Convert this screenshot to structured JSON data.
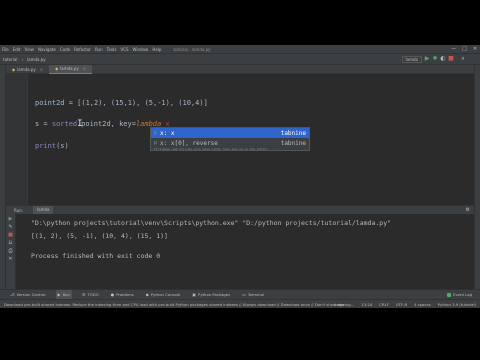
{
  "window": {
    "menu": [
      "File",
      "Edit",
      "View",
      "Navigate",
      "Code",
      "Refactor",
      "Run",
      "Tools",
      "VCS",
      "Window",
      "Help"
    ],
    "title": "tutorial - lamda.py",
    "controls": [
      "—",
      "□",
      "✕"
    ]
  },
  "navbar": {
    "breadcrumbs": [
      "tutorial",
      "lamda.py"
    ],
    "run_config": "lamda"
  },
  "tabs": [
    {
      "label": "lamda.py",
      "icon": "python-file-icon",
      "active": false
    },
    {
      "label": "lamda.py",
      "icon": "python-file-icon",
      "active": true
    }
  ],
  "editor": {
    "line1": "point2d = [(1,2), (15,1), (5,-1), (10,4)]",
    "line2_a": "s = ",
    "line2_fn": "sorted",
    "line2_b": "point2d, key=",
    "line2_lam": "lambda",
    "line2_c": " x",
    "line3_fn": "print",
    "line3_rest": "(s)",
    "footer": "sorted()"
  },
  "completion": {
    "items": [
      {
        "icon": "p",
        "text": "x: x",
        "source": "tabnine",
        "selected": true
      },
      {
        "icon": "p",
        "text": "x: x[0], reverse",
        "source": "tabnine",
        "selected": false
      }
    ],
    "footer": "Ctrl+Down and Ctrl+Up will move caret down and up in the editor"
  },
  "run_panel": {
    "tabs": [
      "Run:",
      "lamda"
    ],
    "command": "\"D:\\python projects\\tutorial\\venv\\Scripts\\python.exe\" \"D:/python projects/tutorial/lamda.py\"",
    "output": "[(1, 2), (5, -1), (10, 4), (15, 1)]",
    "exit": "Process finished with exit code 0"
  },
  "bottom_tools": [
    "Version Control",
    "Run",
    "TODO",
    "Problems",
    "Python Console",
    "Python Packages",
    "Terminal"
  ],
  "event_log": "Event Log",
  "statusbar": {
    "message": "Download pre-built shared indexes: Reduce the indexing time and CPU load with pre-built Python packages shared indexes // Always download // Download once // Don't show again // Configure...",
    "right": [
      "Indexing...",
      "13:24",
      "CRLF",
      "UTF-8",
      "4 spaces",
      "Python 3.9 (tutorial)"
    ]
  },
  "colors": {
    "accent": "#2f65ca",
    "keyword": "#cc7832",
    "builtin": "#8888c6",
    "text": "#a9b7c6"
  }
}
